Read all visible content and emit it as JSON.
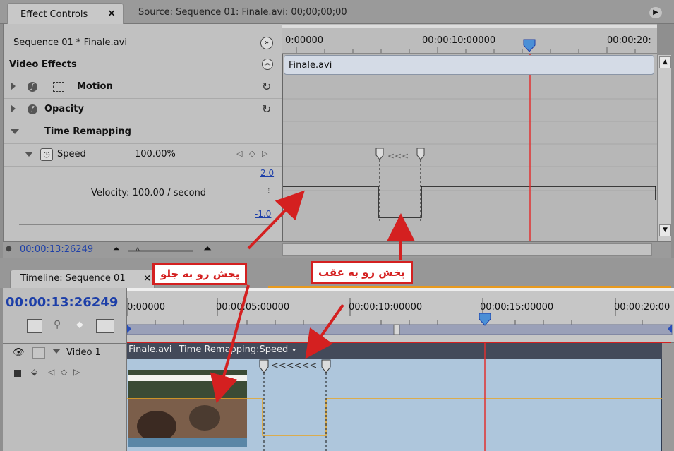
{
  "tabs": {
    "effect_controls": "Effect Controls",
    "close_glyph": "×",
    "source": "Source: Sequence 01: Finale.avi: 00;00;00;00"
  },
  "effect_controls": {
    "clip_header": "Sequence 01 * Finale.avi",
    "section_title": "Video Effects",
    "effects": [
      {
        "name": "Motion"
      },
      {
        "name": "Opacity"
      },
      {
        "name": "Time Remapping"
      }
    ],
    "speed": {
      "label": "Speed",
      "value": "100.00%"
    },
    "graph_max": "2.0",
    "graph_min": "-1.0",
    "velocity": "Velocity: 100.00 / second",
    "ruler_ticks": [
      "0:00000",
      "00:00:10:00000",
      "00:00:20:"
    ],
    "clip_bar": "Finale.avi",
    "current_time": "00:00:13:26249"
  },
  "timeline": {
    "tab_title": "Timeline: Sequence 01",
    "current_time": "00:00:13:26249",
    "ruler_ticks": [
      "0:00000",
      "00:00:05:00000",
      "00:00:10:00000",
      "00:00:15:00000",
      "00:00:20:00"
    ],
    "track_name": "Video 1",
    "clip_name": "Finale.avi",
    "clip_effect": "Time Remapping:Speed"
  },
  "annotations": {
    "forward": "پخش رو به جلو",
    "reverse": "پخش رو به عقب"
  },
  "colors": {
    "accent_red": "#d42020",
    "playhead_red": "#e03030",
    "timecode_blue": "#1d3fa8",
    "tab_orange": "#e89a1e",
    "clip_blue": "#aec6dc"
  }
}
